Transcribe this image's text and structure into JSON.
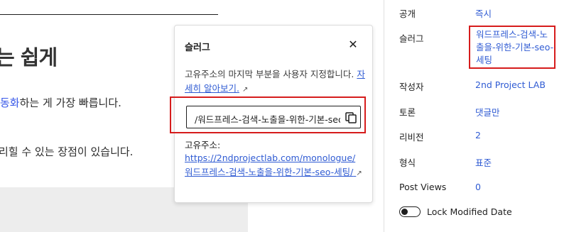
{
  "editor": {
    "heading_fragment": "는 쉽게",
    "paragraph1_link_fragment": "동화",
    "paragraph1_rest": "하는 게 가장 빠릅니다.",
    "paragraph2": "리힐 수 있는 장점이 있습니다."
  },
  "sidebar": {
    "rows": [
      {
        "label": "공개",
        "value": "즉시"
      },
      {
        "label": "슬러그",
        "value": "워드프레스-검색-노출을-위한-기본-seo-세팅"
      },
      {
        "label": "작성자",
        "value": "2nd Project LAB"
      },
      {
        "label": "토론",
        "value": "댓글만"
      },
      {
        "label": "리비전",
        "value": "2"
      },
      {
        "label": "형식",
        "value": "표준"
      },
      {
        "label": "Post Views",
        "value": "0"
      }
    ],
    "toggle_label": "Lock Modified Date"
  },
  "popover": {
    "title": "슬러그",
    "close_symbol": "✕",
    "description": "고유주소의 마지막 부분을 사용자 지정합니다.",
    "learn_more": "자세히 알아보기.",
    "slug_value": "/워드프레스-검색-노출을-위한-기본-seo-세팅",
    "permalink_label": "고유주소:",
    "permalink_url": "https://2ndprojectlab.com/monologue/워드프레스-검색-노출을-위한-기본-seo-세팅/"
  },
  "colors": {
    "accent": "#2f5bd3",
    "highlight_frame": "#d61c1c"
  },
  "icons": {
    "close": "close-icon",
    "copy": "copy-icon",
    "external": "external-link-icon"
  }
}
